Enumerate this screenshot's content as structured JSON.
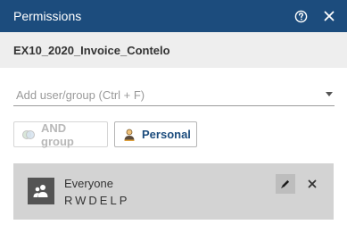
{
  "window": {
    "title": "Permissions",
    "icons": [
      "help-icon",
      "close-icon"
    ]
  },
  "document": {
    "name": "EX10_2020_Invoice_Contelo"
  },
  "add_field": {
    "placeholder": "Add user/group (Ctrl + F)",
    "value": ""
  },
  "buttons": {
    "and_group": "AND group",
    "personal": "Personal"
  },
  "entries": [
    {
      "name": "Everyone",
      "permissions": "RWDELP",
      "icon": "group-avatar-icon"
    }
  ],
  "colors": {
    "titlebar": "#1c4c7d",
    "subheader": "#eeeeee",
    "entry_row": "#d3d3d3",
    "accent_text": "#1c4c7d"
  }
}
